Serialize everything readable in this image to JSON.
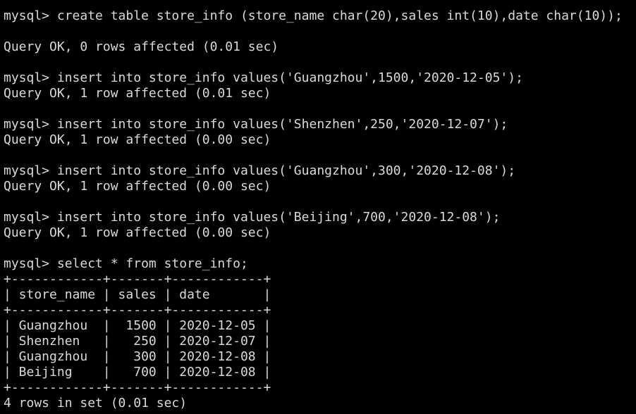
{
  "terminal": {
    "colors": {
      "background": "#000000",
      "foreground": "#d9d9d9"
    },
    "lines": [
      "mysql> create table store_info (store_name char(20),sales int(10),date char(10));",
      "",
      "Query OK, 0 rows affected (0.01 sec)",
      "",
      "mysql> insert into store_info values('Guangzhou',1500,'2020-12-05');",
      "Query OK, 1 row affected (0.01 sec)",
      "",
      "mysql> insert into store_info values('Shenzhen',250,'2020-12-07');",
      "Query OK, 1 row affected (0.00 sec)",
      "",
      "mysql> insert into store_info values('Guangzhou',300,'2020-12-08');",
      "Query OK, 1 row affected (0.00 sec)",
      "",
      "mysql> insert into store_info values('Beijing',700,'2020-12-08');",
      "Query OK, 1 row affected (0.00 sec)",
      "",
      "mysql> select * from store_info;",
      "+------------+-------+------------+",
      "| store_name | sales | date       |",
      "+------------+-------+------------+",
      "| Guangzhou  |  1500 | 2020-12-05 |",
      "| Shenzhen   |   250 | 2020-12-07 |",
      "| Guangzhou  |   300 | 2020-12-08 |",
      "| Beijing    |   700 | 2020-12-08 |",
      "+------------+-------+------------+",
      "4 rows in set (0.01 sec)"
    ]
  }
}
